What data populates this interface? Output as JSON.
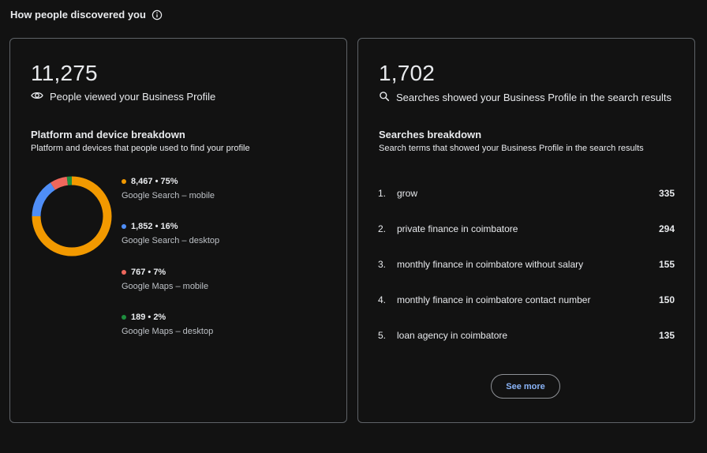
{
  "header": {
    "title": "How people discovered you",
    "info_icon": "info-circle-icon"
  },
  "views_card": {
    "total": "11,275",
    "total_label": "People viewed your Business Profile",
    "icon": "eye-icon",
    "breakdown_title": "Platform and device breakdown",
    "breakdown_desc": "Platform and devices that people used to find your profile",
    "segments": [
      {
        "value": "8,467 • 75%",
        "label": "Google Search – mobile",
        "color": "#f29900",
        "percent": 75
      },
      {
        "value": "1,852 • 16%",
        "label": "Google Search – desktop",
        "color": "#4f8ef7",
        "percent": 16
      },
      {
        "value": "767 • 7%",
        "label": "Google Maps – mobile",
        "color": "#ee675c",
        "percent": 7
      },
      {
        "value": "189 • 2%",
        "label": "Google Maps – desktop",
        "color": "#1e8e3e",
        "percent": 2
      }
    ]
  },
  "searches_card": {
    "total": "1,702",
    "total_label": "Searches showed your Business Profile in the search results",
    "icon": "search-icon",
    "breakdown_title": "Searches breakdown",
    "breakdown_desc": "Search terms that showed your Business Profile in the search results",
    "terms": [
      {
        "rank": "1.",
        "term": "grow",
        "count": "335"
      },
      {
        "rank": "2.",
        "term": "private finance in coimbatore",
        "count": "294"
      },
      {
        "rank": "3.",
        "term": "monthly finance in coimbatore without salary",
        "count": "155"
      },
      {
        "rank": "4.",
        "term": "monthly finance in coimbatore contact number",
        "count": "150"
      },
      {
        "rank": "5.",
        "term": "loan agency in coimbatore",
        "count": "135"
      }
    ],
    "see_more_label": "See more"
  }
}
